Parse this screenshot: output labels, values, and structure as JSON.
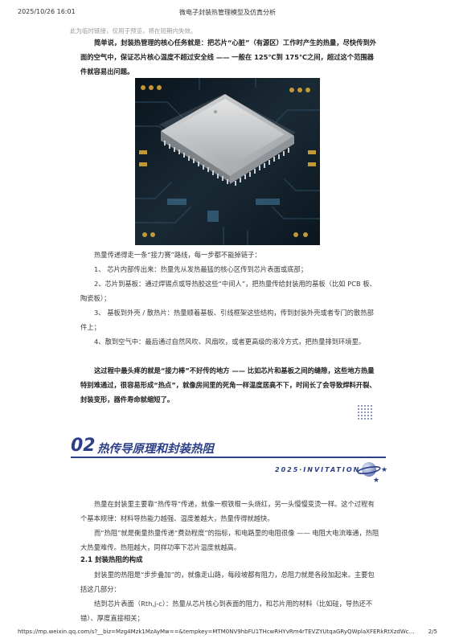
{
  "header": {
    "date": "2025/10/26 16:01",
    "title": "微电子封装热管理模型及仿真分析"
  },
  "note": "此为临时链接，仅用于预览，将在短期内失效。",
  "intro": "简单说，封装热管理的核心任务就是：把芯片“心脏”（有源区）工作时产生的热量，尽快传到外面的空气中，保证芯片核心温度不超过安全线 —— 一般在 125℃到 175℃之间，超过这个范围器件就容易出问题。",
  "chain": {
    "lead": "热量传递得走一条“接力赛”路线，每一步都不能掉链子：",
    "steps": [
      "1、 芯片内部传出来：热量先从发热最猛的核心区传到芯片表面或底部；",
      "2、芯片到基板：通过焊锡点或导热胶这些“中间人”，把热量传给封装用的基板（比如 PCB 板、陶瓷板）；",
      "3、 基板到外壳 / 散热片：热量顺着基板、引线框架这些结构，传到封装外壳或者专门的散热部件上；",
      "4、散到空气中：最后通过自然风吹、风扇吹，或者更高级的液冷方式，把热量排到环境里。"
    ],
    "summary": "这过程中最头疼的就是“接力棒”不好传的地方 —— 比如芯片和基板之间的缝隙，这些地方热量特别难通过，很容易形成“热点”，就像房间里的死角一样温度居高不下，时间长了会导致焊料开裂、封装变形，器件寿命就缩短了。"
  },
  "section": {
    "number": "02",
    "title": "热传导原理和封装热阻",
    "invitation": "2025·INVITATION",
    "p1": "热量在封装里主要靠“热传导”传递，就像一根铁棍一头烧红，另一头慢慢变烫一样。这个过程有个基本规律：材料导热能力越强、温度差越大，热量传得就越快。",
    "p2": "而“热阻”就是衡量热量传递“费劲程度”的指标，和电路里的电阻很像 —— 电阻大电流难通，热阻大热量难传。热阻越大，同样功率下芯片温度就越高。",
    "sub_heading": "2.1 封装热阻的构成",
    "p3": "封装里的热阻是“步步叠加”的，就像走山路，每段坡都有阻力，总阻力就是各段加起来。主要包括这几部分：",
    "p4": "结到芯片表面（Rth,j-c）：热量从芯片核心到表面的阻力，和芯片用的材料（比如硅，导热还不错）、厚度直接相关；"
  },
  "footer": {
    "url": "https://mp.weixin.qq.com/s?__biz=Mzg4Mzk1MzAyMw==&tempkey=MTM0NV9hbFU1THcwRHYvRm4rTEVZYUtqaGRyQWplaXFERkRtXzdWcm…",
    "page": "2/5"
  }
}
